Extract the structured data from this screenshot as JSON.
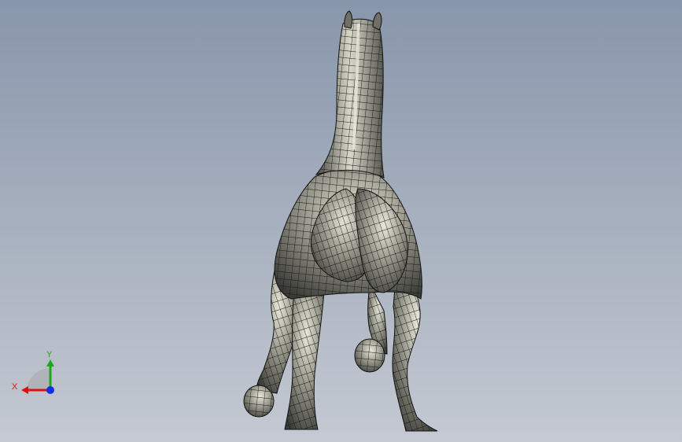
{
  "viewport": {
    "background_top": "#8896ab",
    "background_bottom": "#c4c9d2",
    "model": {
      "icon": "horse-mesh-model",
      "mesh_color": "#1c1c1c",
      "shade_color": "#8d8d82"
    }
  },
  "triad": {
    "x_label": "X",
    "y_label": "Y",
    "x_color": "#e01010",
    "y_color": "#1aa81a",
    "z_color": "#1030e0"
  }
}
